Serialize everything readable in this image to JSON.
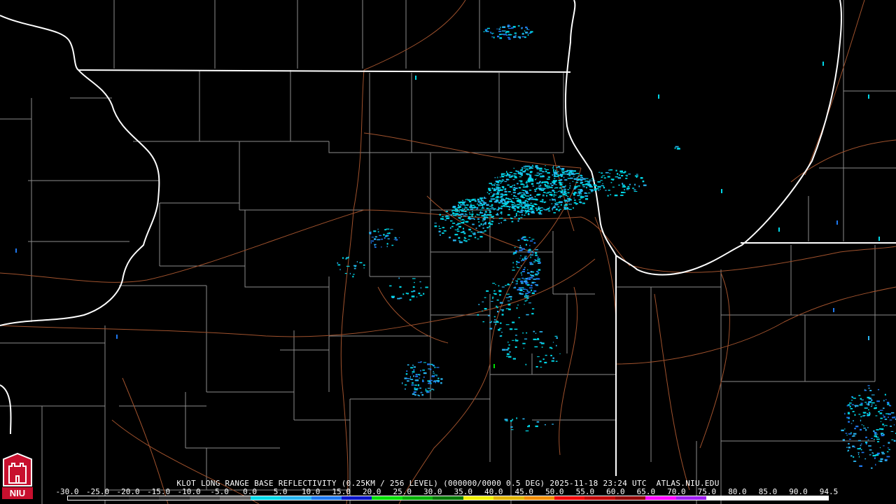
{
  "product": {
    "caption": "KLOT LONG RANGE BASE REFLECTIVITY (0.25KM / 256 LEVEL) (000000/0000 0.5 DEG) 2025-11-18 23:24 UTC  ATLAS.NIU.EDU"
  },
  "logo": {
    "text": "NIU",
    "icon": "niu-castle-logo-icon",
    "color": "#c8102e"
  },
  "scale": {
    "labels": [
      "-30.0",
      "-25.0",
      "-20.0",
      "-15.0",
      "-10.0",
      "-5.0",
      "0.0",
      "5.0",
      "10.0",
      "15.0",
      "20.0",
      "25.0",
      "30.0",
      "35.0",
      "40.0",
      "45.0",
      "50.0",
      "55.0",
      "60.0",
      "65.0",
      "70.0",
      "75.0",
      "80.0",
      "85.0",
      "90.0",
      "94.5"
    ],
    "colors": [
      "#000000",
      "#101010",
      "#1c1c1c",
      "#303030",
      "#484848",
      "#646464",
      "#00d8e8",
      "#28b4f0",
      "#1e78f0",
      "#0a14c8",
      "#00e000",
      "#00b000",
      "#007800",
      "#f0f000",
      "#e0b400",
      "#f08c00",
      "#f00000",
      "#c00000",
      "#900000",
      "#ff00ff",
      "#a020f0",
      "#ffffff",
      "#ffffff",
      "#ffffff",
      "#ffffff"
    ]
  },
  "map_colors": {
    "background": "#000000",
    "state_lines": "#ffffff",
    "county_lines": "#8c8c8c",
    "roads": "#a0522d",
    "echo_light": "#00d8e8",
    "echo_mid": "#28b4f0",
    "echo_deep": "#1e78f0",
    "echo_green": "#00e000"
  }
}
